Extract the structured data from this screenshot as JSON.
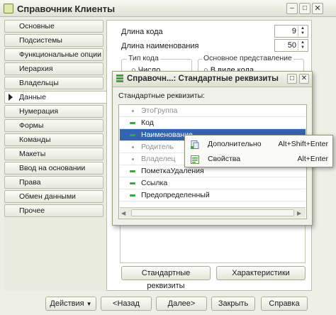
{
  "window": {
    "title": "Справочник Клиенты"
  },
  "nav": {
    "items": [
      {
        "label": "Основные"
      },
      {
        "label": "Подсистемы"
      },
      {
        "label": "Функциональные опции"
      },
      {
        "label": "Иерархия"
      },
      {
        "label": "Владельцы"
      },
      {
        "label": "Данные"
      },
      {
        "label": "Нумерация"
      },
      {
        "label": "Формы"
      },
      {
        "label": "Команды"
      },
      {
        "label": "Макеты"
      },
      {
        "label": "Ввод на основании"
      },
      {
        "label": "Права"
      },
      {
        "label": "Обмен данными"
      },
      {
        "label": "Прочее"
      }
    ]
  },
  "data_tab": {
    "code_length_label": "Длина кода",
    "code_length_value": "9",
    "name_length_label": "Длина наименования",
    "name_length_value": "50",
    "code_type_group": "Тип кода",
    "code_type_option": "Число",
    "presentation_group": "Основное представление",
    "presentation_option": "В виде кода",
    "std_attrs_button": "Стандартные реквизиты",
    "characteristics_button": "Характеристики"
  },
  "dialog": {
    "title": "Справочн...: Стандартные реквизиты",
    "list_label": "Стандартные реквизиты:",
    "rows": [
      {
        "label": "ЭтоГруппа"
      },
      {
        "label": "Код"
      },
      {
        "label": "Наименование"
      },
      {
        "label": "Родитель"
      },
      {
        "label": "Владелец"
      },
      {
        "label": "ПометкаУдаления"
      },
      {
        "label": "Ссылка"
      },
      {
        "label": "Предопределенный"
      }
    ]
  },
  "context_menu": {
    "items": [
      {
        "label": "Дополнительно",
        "shortcut": "Alt+Shift+Enter"
      },
      {
        "label": "Свойства",
        "shortcut": "Alt+Enter"
      }
    ]
  },
  "footer": {
    "actions": "Действия",
    "back": "<Назад",
    "next": "Далее>",
    "close": "Закрыть",
    "help": "Справка"
  }
}
